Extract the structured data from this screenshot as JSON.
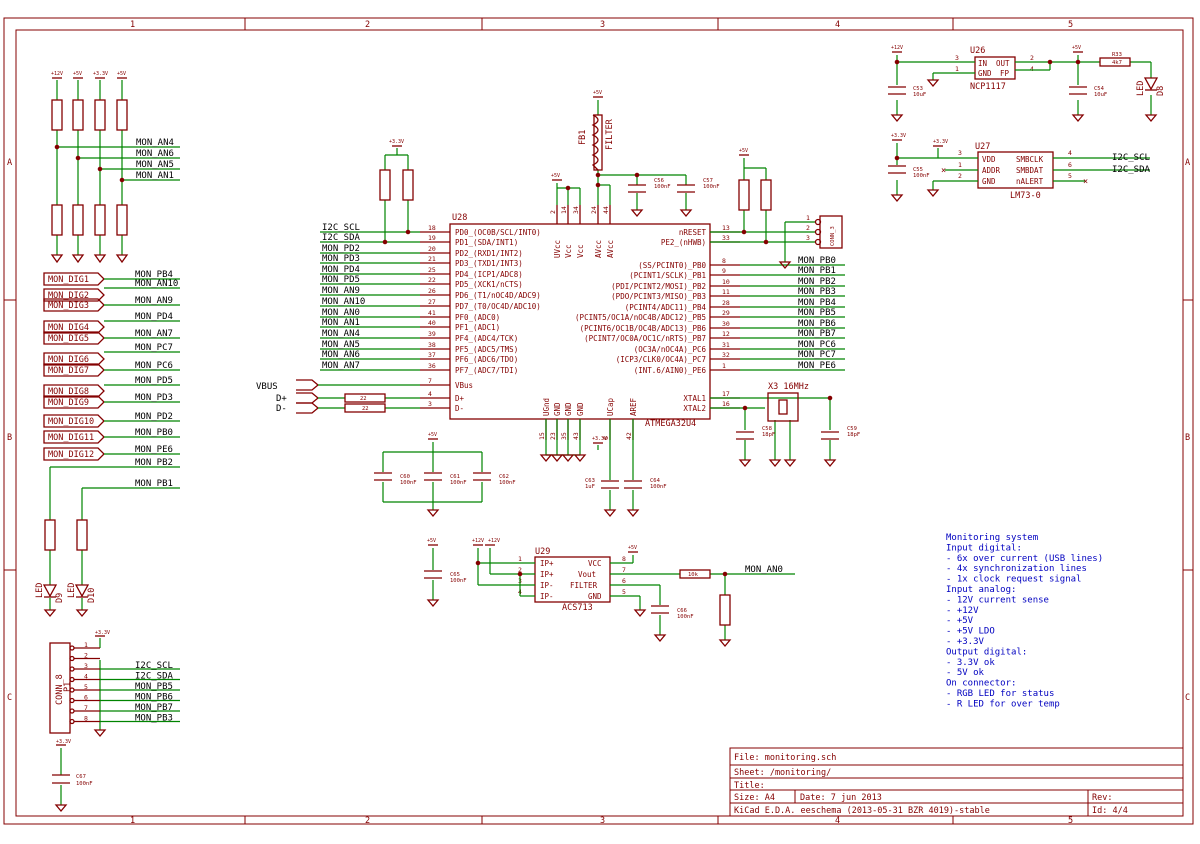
{
  "frame": {
    "cols": [
      "1",
      "2",
      "3",
      "4",
      "5"
    ],
    "rows": [
      "A",
      "B",
      "C"
    ]
  },
  "title_block": {
    "file": "File: monitoring.sch",
    "sheet": "Sheet: /monitoring/",
    "title": "Title:",
    "size": "Size: A4",
    "date": "Date: 7 jun 2013",
    "rev": "Rev:",
    "kicad": "KiCad E.D.A.  eeschema (2013-05-31 BZR 4019)-stable",
    "id": "Id: 4/4"
  },
  "notes": [
    "Monitoring system",
    "Input digital:",
    "- 6x over current (USB lines)",
    "- 4x synchronization lines",
    "- 1x clock request signal",
    "Input analog:",
    "- 12V current sense",
    "- +12V",
    "- +5V",
    "- +5V LDO",
    "- +3.3V",
    "Output digital:",
    "- 3.3V ok",
    "- 5V ok",
    "On connector:",
    "- RGB LED for status",
    "- R LED for over temp"
  ],
  "mcu": {
    "ref": "U28",
    "value": "ATMEGA32U4",
    "left_pins": [
      {
        "num": "18",
        "name": "PD0_(OC0B/SCL/INT0)",
        "net": "I2C_SCL"
      },
      {
        "num": "19",
        "name": "PD1_(SDA/INT1)",
        "net": "I2C_SDA"
      },
      {
        "num": "20",
        "name": "PD2_(RXD1/INT2)",
        "net": "MON_PD2"
      },
      {
        "num": "21",
        "name": "PD3_(TXD1/INT3)",
        "net": "MON_PD3"
      },
      {
        "num": "25",
        "name": "PD4_(ICP1/ADC8)",
        "net": "MON_PD4"
      },
      {
        "num": "22",
        "name": "PD5_(XCK1/nCTS)",
        "net": "MON_PD5"
      },
      {
        "num": "26",
        "name": "PD6_(T1/nOC4D/ADC9)",
        "net": "MON_AN9"
      },
      {
        "num": "27",
        "name": "PD7_(T0/OC4D/ADC10)",
        "net": "MON_AN10"
      },
      {
        "num": "41",
        "name": "PF0_(ADC0)",
        "net": "MON_AN0"
      },
      {
        "num": "40",
        "name": "PF1_(ADC1)",
        "net": "MON_AN1"
      },
      {
        "num": "39",
        "name": "PF4_(ADC4/TCK)",
        "net": "MON_AN4"
      },
      {
        "num": "38",
        "name": "PF5_(ADC5/TMS)",
        "net": "MON_AN5"
      },
      {
        "num": "37",
        "name": "PF6_(ADC6/TDO)",
        "net": "MON_AN6"
      },
      {
        "num": "36",
        "name": "PF7_(ADC7/TDI)",
        "net": "MON_AN7"
      },
      {
        "num": "7",
        "name": "VBus",
        "net": ""
      },
      {
        "num": "4",
        "name": "D+",
        "net": ""
      },
      {
        "num": "3",
        "name": "D-",
        "net": ""
      }
    ],
    "right_pins": [
      {
        "num": "13",
        "name": "nRESET",
        "net": ""
      },
      {
        "num": "33",
        "name": "PE2_(nHWB)",
        "net": ""
      },
      {
        "num": "8",
        "name": "(SS/PCINT0)_PB0",
        "net": "MON_PB0"
      },
      {
        "num": "9",
        "name": "(PCINT1/SCLK)_PB1",
        "net": "MON_PB1"
      },
      {
        "num": "10",
        "name": "(PDI/PCINT2/MOSI)_PB2",
        "net": "MON_PB2"
      },
      {
        "num": "11",
        "name": "(PDO/PCINT3/MISO)_PB3",
        "net": "MON_PB3"
      },
      {
        "num": "28",
        "name": "(PCINT4/ADC11)_PB4",
        "net": "MON_PB4"
      },
      {
        "num": "29",
        "name": "(PCINT5/OC1A/nOC4B/ADC12)_PB5",
        "net": "MON_PB5"
      },
      {
        "num": "30",
        "name": "(PCINT6/OC1B/OC4B/ADC13)_PB6",
        "net": "MON_PB6"
      },
      {
        "num": "12",
        "name": "(PCINT7/OC0A/OC1C/nRTS)_PB7",
        "net": "MON_PB7"
      },
      {
        "num": "31",
        "name": "(OC3A/nOC4A)_PC6",
        "net": "MON_PC6"
      },
      {
        "num": "32",
        "name": "(ICP3/CLK0/OC4A)_PC7",
        "net": "MON_PC7"
      },
      {
        "num": "1",
        "name": "(INT.6/AIN0)_PE6",
        "net": "MON_PE6"
      },
      {
        "num": "17",
        "name": "XTAL1",
        "net": ""
      },
      {
        "num": "16",
        "name": "XTAL2",
        "net": ""
      }
    ],
    "top_pins": [
      {
        "num": "2",
        "name": "UVcc"
      },
      {
        "num": "14",
        "name": "Vcc"
      },
      {
        "num": "34",
        "name": "Vcc"
      },
      {
        "num": "24",
        "name": "AVcc"
      },
      {
        "num": "44",
        "name": "AVcc"
      }
    ],
    "bottom_pins": [
      {
        "num": "15",
        "name": "UGnd"
      },
      {
        "num": "23",
        "name": "GND"
      },
      {
        "num": "35",
        "name": "GND"
      },
      {
        "num": "43",
        "name": "GND"
      },
      {
        "num": "6",
        "name": "UCap"
      },
      {
        "num": "42",
        "name": "AREF"
      }
    ]
  },
  "mon_an_labels": [
    "MON_AN4",
    "MON_AN6",
    "MON_AN5",
    "MON_AN1"
  ],
  "dig_rows": [
    {
      "label": "MON_DIG1",
      "net": "MON_PB4"
    },
    {
      "label": "",
      "net": "MON_AN10"
    },
    {
      "label": "MON_DIG2",
      "net": ""
    },
    {
      "label": "MON_DIG3",
      "net": "MON_AN9"
    },
    {
      "label": "",
      "net": "MON_PD4"
    },
    {
      "label": "MON_DIG4",
      "net": ""
    },
    {
      "label": "MON_DIG5",
      "net": "MON_AN7"
    },
    {
      "label": "",
      "net": "MON_PC7"
    },
    {
      "label": "MON_DIG6",
      "net": ""
    },
    {
      "label": "MON_DIG7",
      "net": "MON_PC6"
    },
    {
      "label": "",
      "net": "MON_PD5"
    },
    {
      "label": "MON_DIG8",
      "net": ""
    },
    {
      "label": "MON_DIG9",
      "net": "MON_PD3"
    },
    {
      "label": "MON_DIG10",
      "net": "MON_PD2"
    },
    {
      "label": "MON_DIG11",
      "net": "MON_PB0"
    },
    {
      "label": "MON_DIG12",
      "net": "MON_PE6"
    },
    {
      "label": "",
      "net": "MON_PB2"
    },
    {
      "label": "",
      "net": "MON_PB1"
    }
  ],
  "usb": {
    "vbus": "VBUS",
    "dp": "D+",
    "dm": "D-",
    "r_dp": "22",
    "r_dm": "22"
  },
  "conn3": {
    "ref": "CONN_3",
    "pins": [
      "1",
      "2",
      "3"
    ]
  },
  "crystal": {
    "ref": "X3 16MHz",
    "c1": "C58",
    "c2": "C59",
    "c1v": "18pF",
    "c2v": "18pF"
  },
  "fb1": {
    "ref": "FB1",
    "value": "FILTER",
    "c56": "C56",
    "c56v": "100nF",
    "c57": "C57",
    "c57v": "100nF"
  },
  "u26": {
    "ref": "U26",
    "value": "NCP1117",
    "in": "IN",
    "out": "OUT",
    "gnd": "GND",
    "fp": "FP",
    "p3": "3",
    "p1": "1",
    "p2": "2",
    "p4": "4",
    "r33": "R33",
    "r33v": "4k7",
    "c53": "C53",
    "c53v": "10uF",
    "c54": "C54",
    "c54v": "10uF",
    "d8": "LED",
    "d8r": "D8"
  },
  "u27": {
    "ref": "U27",
    "value": "LM73-0",
    "pins": [
      {
        "num": "3",
        "name": "VDD"
      },
      {
        "num": "1",
        "name": "ADDR"
      },
      {
        "num": "2",
        "name": "GND"
      }
    ],
    "rpins": [
      {
        "num": "4",
        "name": "SMBCLK",
        "net": "I2C_SCL"
      },
      {
        "num": "6",
        "name": "SMBDAT",
        "net": "I2C_SDA"
      },
      {
        "num": "5",
        "name": "nALERT",
        "net": ""
      }
    ],
    "c55": "C55",
    "c55v": "100nF"
  },
  "u29": {
    "ref": "U29",
    "value": "ACS713",
    "lpins": [
      {
        "num": "1",
        "name": "IP+"
      },
      {
        "num": "2",
        "name": "IP+"
      },
      {
        "num": "3",
        "name": "IP-"
      },
      {
        "num": "4",
        "name": "IP-"
      }
    ],
    "rpins": [
      {
        "num": "8",
        "name": "VCC"
      },
      {
        "num": "7",
        "name": "Vout"
      },
      {
        "num": "6",
        "name": "FILTER"
      },
      {
        "num": "5",
        "name": "GND"
      }
    ],
    "net": "MON_AN0",
    "r": "10k",
    "c65": "C65",
    "c65v": "100nF",
    "c66": "C66",
    "c66v": "100nF"
  },
  "conn8": {
    "ref": "CONN_8",
    "p": "P1",
    "pins": [
      "1",
      "2",
      "3",
      "4",
      "5",
      "6",
      "7",
      "8"
    ],
    "nets": [
      "",
      "",
      "I2C_SCL",
      "I2C_SDA",
      "MON_PB5",
      "MON_PB6",
      "MON_PB7",
      "MON_PB3"
    ],
    "c67": "C67",
    "c67v": "100nF"
  },
  "leds": {
    "d9": "D9",
    "d10": "D10",
    "led": "LED"
  },
  "caps_bottom": {
    "c60": "C60",
    "c61": "C61",
    "c62": "C62",
    "c63": "C63",
    "c64": "C64",
    "v60": "100nF",
    "v61": "100nF",
    "v62": "100nF",
    "v63": "1uF",
    "v64": "100nF"
  },
  "power_labels": {
    "p12": "+12V",
    "p5": "+5V",
    "p33": "+3.3V"
  }
}
